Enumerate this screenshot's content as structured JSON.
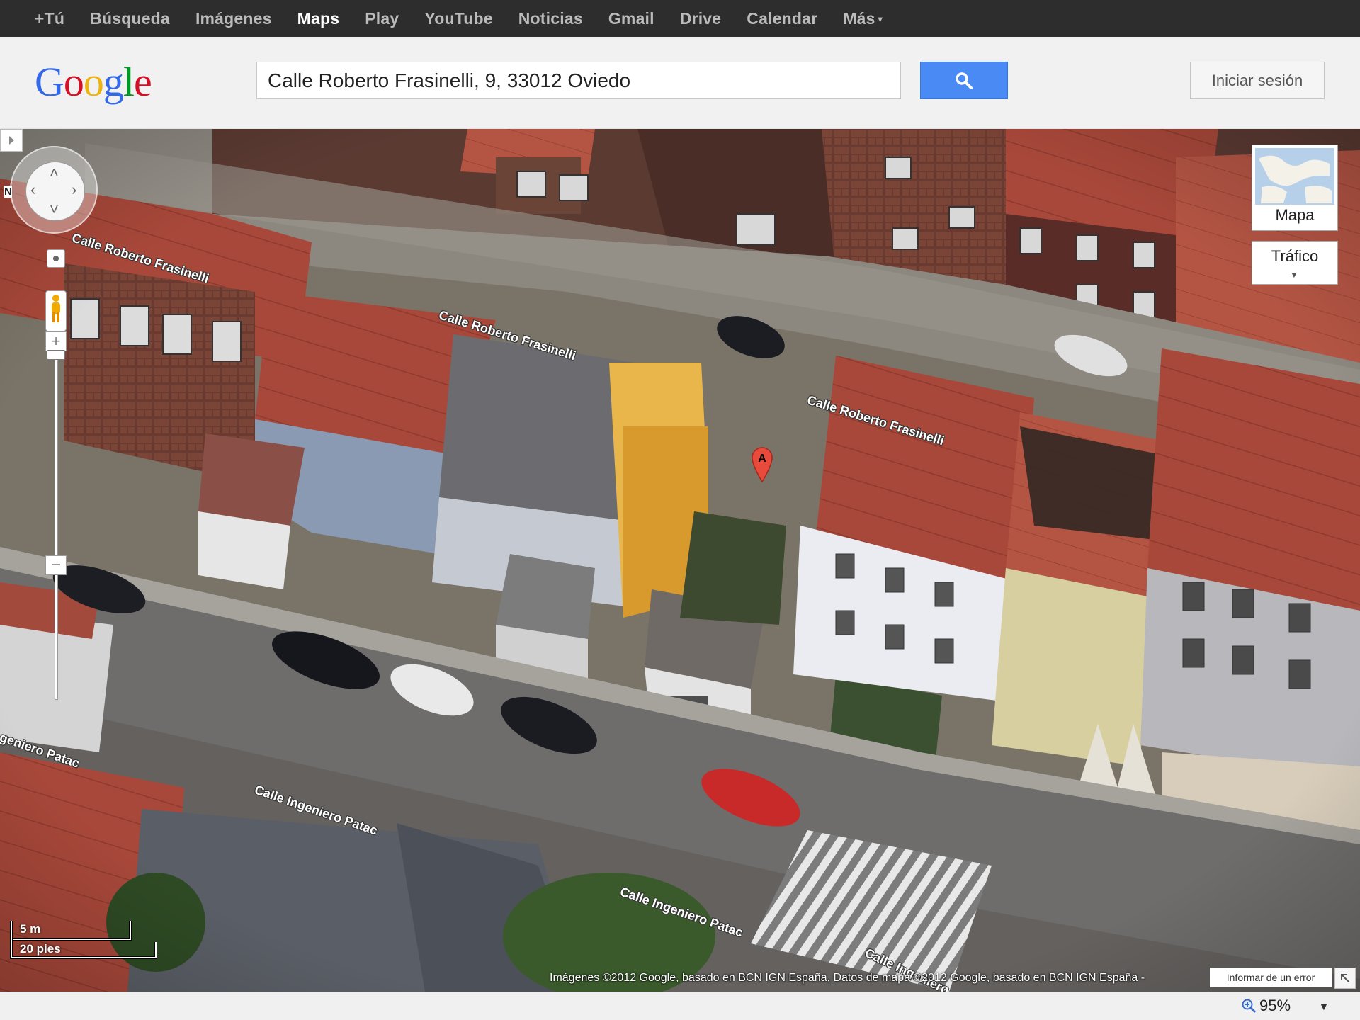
{
  "topbar": {
    "items": [
      {
        "label": "+Tú"
      },
      {
        "label": "Búsqueda"
      },
      {
        "label": "Imágenes"
      },
      {
        "label": "Maps",
        "active": true
      },
      {
        "label": "Play"
      },
      {
        "label": "YouTube"
      },
      {
        "label": "Noticias"
      },
      {
        "label": "Gmail"
      },
      {
        "label": "Drive"
      },
      {
        "label": "Calendar"
      },
      {
        "label": "Más"
      }
    ]
  },
  "header": {
    "logo": {
      "letters": [
        "G",
        "o",
        "o",
        "g",
        "l",
        "e"
      ],
      "colors": [
        "#3369e8",
        "#d50f25",
        "#eeb211",
        "#3369e8",
        "#009925",
        "#d50f25"
      ]
    },
    "search": {
      "value": "Calle Roberto Frasinelli, 9, 33012 Oviedo",
      "button_icon": "search-icon",
      "button_color": "#4a8af4"
    },
    "signin_label": "Iniciar sesión"
  },
  "map": {
    "view": "satellite-45",
    "street_labels": [
      {
        "text": "Calle Roberto Frasinelli"
      },
      {
        "text": "Calle Roberto Frasinelli"
      },
      {
        "text": "Calle Roberto Frasinelli"
      },
      {
        "text": "Calle Ingeniero Patac"
      },
      {
        "text": "Calle Ingeniero Patac"
      },
      {
        "text": "geniero Patac"
      },
      {
        "text": "Calle Ingeniero"
      }
    ],
    "controls": {
      "north_label": "N",
      "map_type_label": "Mapa",
      "traffic_label": "Tráfico",
      "zoom_in": "+",
      "zoom_out": "−"
    },
    "marker": {
      "label": "A",
      "color": "#e84a3c"
    },
    "scale": {
      "top": "5 m",
      "bottom": "20 pies"
    },
    "attribution": "Imágenes ©2012 Google, basado en BCN IGN España, Datos de mapa ©2012 Google, basado en BCN IGN España -",
    "report_error_label": "Informar de un error"
  },
  "statusbar": {
    "zoom_level": "95%"
  }
}
